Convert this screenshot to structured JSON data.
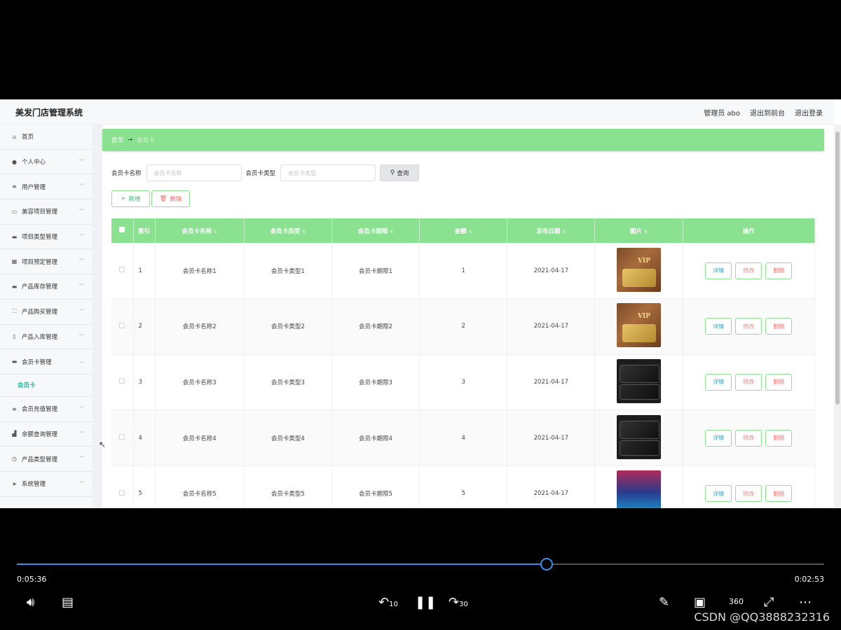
{
  "app": {
    "title": "美发门店管理系统",
    "admin_label": "管理员 abo",
    "back_link": "退出到前台",
    "logout_link": "退出登录"
  },
  "sidebar": {
    "items": [
      {
        "label": "首页",
        "icon": "home-icon",
        "glyph": "⌂"
      },
      {
        "label": "个人中心",
        "icon": "user-icon",
        "glyph": "●"
      },
      {
        "label": "用户管理",
        "icon": "sliders-icon",
        "glyph": "≡"
      },
      {
        "label": "美容项目管理",
        "icon": "chat-icon",
        "glyph": "▭"
      },
      {
        "label": "项目类型管理",
        "icon": "monitor-icon",
        "glyph": "▬"
      },
      {
        "label": "项目预定管理",
        "icon": "grid-icon",
        "glyph": "▦"
      },
      {
        "label": "产品库存管理",
        "icon": "message-icon",
        "glyph": "▬"
      },
      {
        "label": "产品购买管理",
        "icon": "fullscreen-icon",
        "glyph": "⛶"
      },
      {
        "label": "产品入库管理",
        "icon": "phone-icon",
        "glyph": "▯"
      },
      {
        "label": "会员卡管理",
        "icon": "card-icon",
        "glyph": "▬"
      }
    ],
    "sub_item": "会员卡",
    "items_after": [
      {
        "label": "会员充值管理",
        "icon": "list-icon",
        "glyph": "≡"
      },
      {
        "label": "余额查询管理",
        "icon": "chart-icon",
        "glyph": "▟"
      },
      {
        "label": "产品类型管理",
        "icon": "compass-icon",
        "glyph": "◷"
      },
      {
        "label": "系统管理",
        "icon": "send-icon",
        "glyph": "➤"
      }
    ]
  },
  "breadcrumb": {
    "home": "首页",
    "arrow": "→",
    "current": "会员卡"
  },
  "search": {
    "name_label": "会员卡名称",
    "name_placeholder": "会员卡名称",
    "type_label": "会员卡类型",
    "type_placeholder": "会员卡类型",
    "query_button": "查询"
  },
  "toolbar": {
    "add_button": "新增",
    "delete_button": "删除"
  },
  "table": {
    "headers": [
      "索引",
      "会员卡名称",
      "会员卡类型",
      "会员卡期限",
      "金额",
      "发布日期",
      "图片",
      "操作"
    ],
    "rows": [
      {
        "index": "1",
        "name": "会员卡名称1",
        "type": "会员卡类型1",
        "term": "会员卡期限1",
        "amount": "1",
        "date": "2021-04-17",
        "image": "gold"
      },
      {
        "index": "2",
        "name": "会员卡名称2",
        "type": "会员卡类型2",
        "term": "会员卡期限2",
        "amount": "2",
        "date": "2021-04-17",
        "image": "gold"
      },
      {
        "index": "3",
        "name": "会员卡名称3",
        "type": "会员卡类型3",
        "term": "会员卡期限3",
        "amount": "3",
        "date": "2021-04-17",
        "image": "dark"
      },
      {
        "index": "4",
        "name": "会员卡名称4",
        "type": "会员卡类型4",
        "term": "会员卡期限4",
        "amount": "4",
        "date": "2021-04-17",
        "image": "dark"
      },
      {
        "index": "5",
        "name": "会员卡名称5",
        "type": "会员卡类型5",
        "term": "会员卡期限5",
        "amount": "5",
        "date": "2021-04-17",
        "image": "color"
      }
    ],
    "row_actions": {
      "detail": "详情",
      "edit": "修改",
      "remove": "删除"
    }
  },
  "player": {
    "elapsed": "0:05:36",
    "remaining": "0:02:53",
    "progress": 0.656,
    "watermark": "CSDN @QQ3888232316",
    "rewind_label": "10",
    "forward_label": "30",
    "vr_label": "360"
  }
}
